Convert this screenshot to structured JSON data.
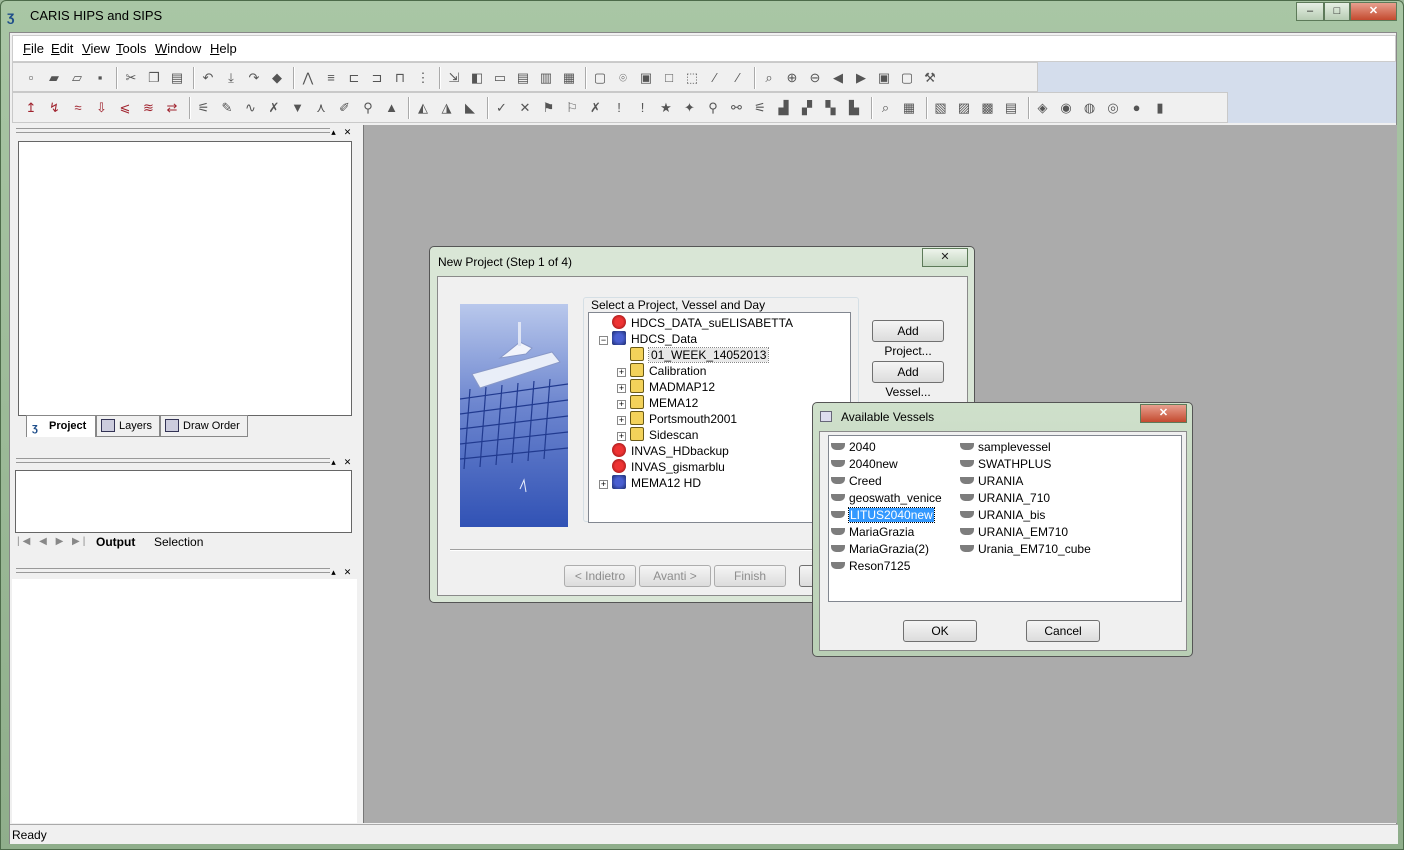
{
  "app": {
    "title": "CARIS HIPS and SIPS",
    "window_buttons": [
      "–",
      "□",
      "✕"
    ]
  },
  "menu": [
    {
      "label": "File",
      "accel": "F",
      "rest": "ile"
    },
    {
      "label": "Edit",
      "accel": "E",
      "rest": "dit"
    },
    {
      "label": "View",
      "accel": "V",
      "rest": "iew"
    },
    {
      "label": "Tools",
      "accel": "T",
      "rest": "ools"
    },
    {
      "label": "Window",
      "accel": "W",
      "rest": "indow"
    },
    {
      "label": "Help",
      "accel": "H",
      "rest": "elp"
    }
  ],
  "toolbar_icons": {
    "row1": [
      "new-icon",
      "open-icon",
      "open-folder-icon",
      "save-icon",
      "cut-icon",
      "copy-icon",
      "paste-icon",
      "undo-icon",
      "import-icon",
      "redo-icon",
      "book-icon",
      "sounding-icon",
      "line-icon",
      "profile-icon",
      "split-icon",
      "merge-icon",
      "filter-icon",
      "arrow-icon",
      "layer-icon",
      "window-icon",
      "panel-icon",
      "panel2-icon",
      "panel3-icon",
      "select-icon",
      "lasso-icon",
      "box-icon",
      "box2-icon",
      "box3-icon",
      "slash-icon",
      "slash2-icon",
      "zoom-icon",
      "zoom-in-icon",
      "zoom-out-icon",
      "back-icon",
      "forward-icon",
      "fit-icon",
      "screen-icon",
      "tools-icon"
    ],
    "row2": [
      "nav-icon",
      "attitude-icon",
      "gyro-icon",
      "height-icon",
      "tide-icon",
      "svp-icon",
      "merge-data-icon",
      "edit-icon",
      "pen-icon",
      "wave-icon",
      "split2-icon",
      "down-icon",
      "graph-icon",
      "brush-icon",
      "wand-icon",
      "tri-icon",
      "tri2-icon",
      "tri3-icon",
      "tri4-icon",
      "check-icon",
      "cross-icon",
      "person-icon",
      "person2-icon",
      "x-icon",
      "warning-icon",
      "warning2-icon",
      "star-icon",
      "star2-icon",
      "find-icon",
      "binoculars-icon",
      "filter2-icon",
      "chart-icon",
      "chart2-icon",
      "chart3-icon",
      "chart4-icon",
      "zoom2-icon",
      "grid-icon",
      "grid2-icon",
      "grid3-icon",
      "grid4-icon",
      "grid5-icon",
      "surface-icon",
      "surface2-icon",
      "surface3-icon",
      "surface4-icon",
      "surface5-icon",
      "surface6-icon"
    ]
  },
  "panels": {
    "project_tabs": [
      {
        "label": "Project",
        "icon": "project-icon"
      },
      {
        "label": "Layers",
        "icon": "layers-icon"
      },
      {
        "label": "Draw Order",
        "icon": "draw-order-icon"
      }
    ],
    "output_tabs": [
      "Output",
      "Selection"
    ],
    "nav_arrows": [
      "|◀",
      "◀",
      "▶",
      "▶|"
    ]
  },
  "status": {
    "text": "Ready"
  },
  "new_project_dialog": {
    "title": "New Project (Step 1 of 4)",
    "group_label": "Select a Project, Vessel and Day",
    "tree": [
      {
        "label": "HDCS_DATA_suELISABETTA",
        "icon": "red",
        "level": 0,
        "expander": ""
      },
      {
        "label": "HDCS_Data",
        "icon": "blue",
        "level": 0,
        "expander": "−"
      },
      {
        "label": "01_WEEK_14052013",
        "icon": "folder",
        "level": 1,
        "expander": "",
        "selected": true
      },
      {
        "label": "Calibration",
        "icon": "folder",
        "level": 1,
        "expander": "+"
      },
      {
        "label": "MADMAP12",
        "icon": "folder",
        "level": 1,
        "expander": "+"
      },
      {
        "label": "MEMA12",
        "icon": "folder",
        "level": 1,
        "expander": "+"
      },
      {
        "label": "Portsmouth2001",
        "icon": "folder",
        "level": 1,
        "expander": "+"
      },
      {
        "label": "Sidescan",
        "icon": "folder",
        "level": 1,
        "expander": "+"
      },
      {
        "label": "INVAS_HDbackup",
        "icon": "red",
        "level": 0,
        "expander": ""
      },
      {
        "label": "INVAS_gismarblu",
        "icon": "red",
        "level": 0,
        "expander": ""
      },
      {
        "label": "MEMA12 HD",
        "icon": "blue",
        "level": 0,
        "expander": "+"
      }
    ],
    "buttons": {
      "add_project": "Add Project...",
      "add_vessel": "Add Vessel...",
      "back": "< Indietro",
      "next": "Avanti >",
      "finish": "Finish"
    }
  },
  "vessels_dialog": {
    "title": "Available Vessels",
    "col1": [
      "2040",
      "2040new",
      "Creed",
      "geoswath_venice",
      "LITUS2040new",
      "MariaGrazia",
      "MariaGrazia(2)",
      "Reson7125"
    ],
    "col2": [
      "samplevessel",
      "SWATHPLUS",
      "URANIA",
      "URANIA_710",
      "URANIA_bis",
      "URANIA_EM710",
      "Urania_EM710_cube"
    ],
    "selected": "LITUS2040new",
    "ok": "OK",
    "cancel": "Cancel"
  }
}
